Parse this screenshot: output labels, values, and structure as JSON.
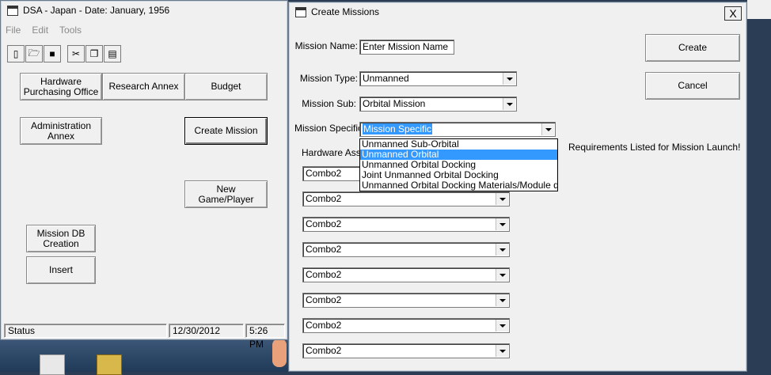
{
  "main_window": {
    "title": "DSA - Japan -  Date:  January, 1956",
    "menu": [
      "File",
      "Edit",
      "Tools"
    ],
    "toolbar": [
      "new-icon",
      "open-icon",
      "save-icon",
      "cut-icon",
      "copy-icon",
      "paste-icon"
    ],
    "buttons": {
      "hardware": "Hardware Purchasing Office",
      "research": "Research Annex",
      "budget": "Budget",
      "administration": "Administration Annex",
      "create_mission": "Create Mission",
      "new_game": "New Game/Player",
      "mission_db": "Mission DB Creation",
      "insert": "Insert"
    },
    "status": {
      "text": "Status",
      "date": "12/30/2012",
      "time": "5:26 PM"
    }
  },
  "dialog": {
    "title": "Create Missions",
    "close_label": "X",
    "mission_name_label": "Mission Name:",
    "mission_name_value": "Enter Mission Name",
    "mission_type_label": "Mission Type:",
    "mission_type_value": "Unmanned",
    "mission_sub_label": "Mission Sub:",
    "mission_sub_value": "Orbital Mission",
    "mission_specific_label": "Mission Specific:",
    "mission_specific_value": "Mission Specific",
    "hardware_label": "Hardware Assi",
    "requirements_text": "Requirements Listed for Mission Launch!",
    "create_label": "Create",
    "cancel_label": "Cancel",
    "dropdown_options": [
      "Unmanned Sub-Orbital",
      "Unmanned Orbital",
      "Unmanned Orbital Docking",
      "Joint Unmanned Orbital Docking",
      "Unmanned Orbital Docking Materials/Module delive"
    ],
    "highlighted_option": "Unmanned Orbital",
    "hardware_combos": [
      "Combo2",
      "Combo2",
      "Combo2",
      "Combo2",
      "Combo2",
      "Combo2",
      "Combo2",
      "Combo2"
    ]
  },
  "colors": {
    "selection": "#3399ff",
    "desktop": "#2a3d55"
  }
}
